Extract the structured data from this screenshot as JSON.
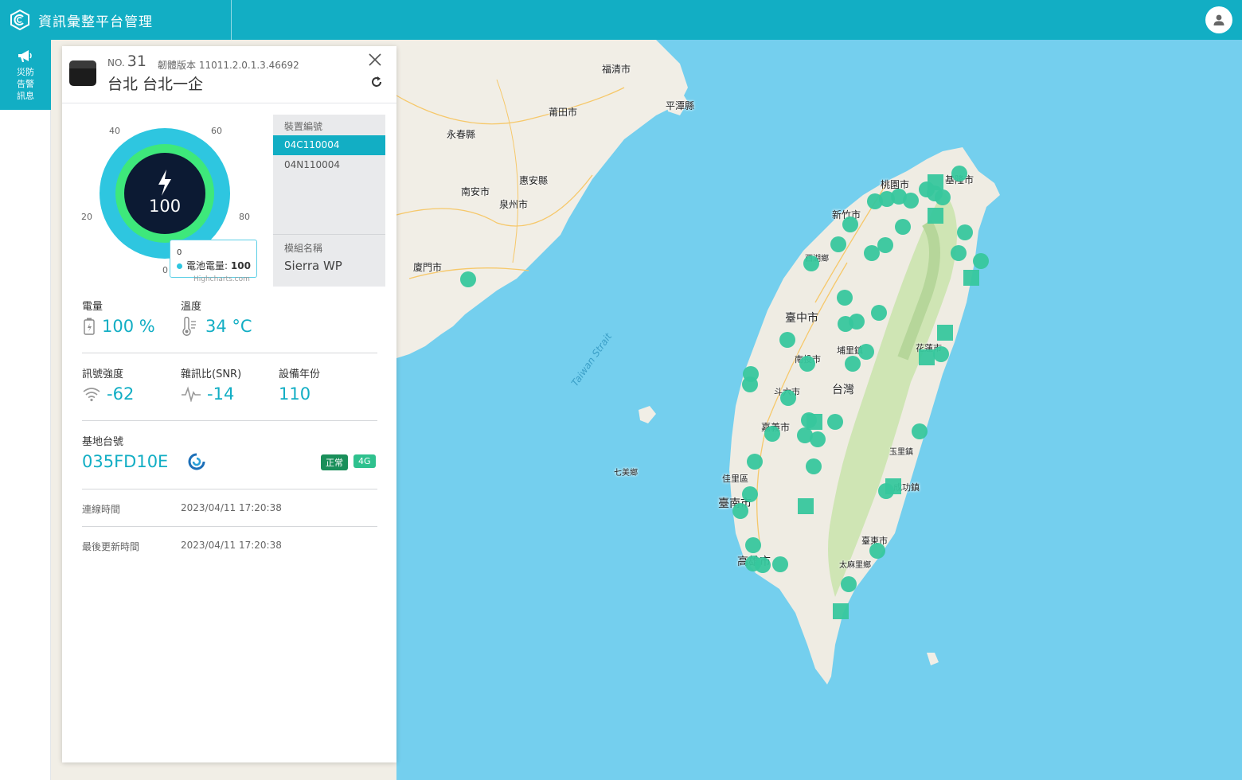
{
  "app": {
    "title": "資訊彙整平台管理"
  },
  "sidebar": {
    "items": [
      {
        "label": "災防告警訊息",
        "icon": "megaphone-icon"
      }
    ]
  },
  "map": {
    "places": [
      {
        "name": "福清市"
      },
      {
        "name": "平潭縣"
      },
      {
        "name": "莆田市"
      },
      {
        "name": "永春縣"
      },
      {
        "name": "惠安縣"
      },
      {
        "name": "南安市"
      },
      {
        "name": "泉州市"
      },
      {
        "name": "廈門市"
      },
      {
        "name": "桃園市"
      },
      {
        "name": "基隆市"
      },
      {
        "name": "新竹市"
      },
      {
        "name": "西湖鄉"
      },
      {
        "name": "臺中市"
      },
      {
        "name": "埔里鎮"
      },
      {
        "name": "南投市"
      },
      {
        "name": "花蓮市"
      },
      {
        "name": "斗六市"
      },
      {
        "name": "台灣"
      },
      {
        "name": "嘉義市"
      },
      {
        "name": "玉里鎮"
      },
      {
        "name": "七美鄉"
      },
      {
        "name": "佳里區"
      },
      {
        "name": "臺南市"
      },
      {
        "name": "成功鎮"
      },
      {
        "name": "臺東市"
      },
      {
        "name": "高雄市"
      },
      {
        "name": "太麻里鄉"
      },
      {
        "name": "Taiwan Strait"
      }
    ]
  },
  "device": {
    "no_label": "NO.",
    "no": "31",
    "firmware": "韌體版本 11011.2.0.1.3.46692",
    "site": "台北 台北一企",
    "gauge": {
      "value": "100",
      "ticks": [
        "0",
        "20",
        "40",
        "60",
        "80"
      ],
      "tooltip_zero": "0",
      "tooltip_label": "電池電量:",
      "tooltip_value": "100",
      "credit": "Highcharts.com"
    },
    "device_ids": {
      "header": "裝置編號",
      "items": [
        "04C110004",
        "04N110004"
      ],
      "selected": "04C110004"
    },
    "module": {
      "header": "模組名稱",
      "value": "Sierra WP"
    },
    "battery": {
      "label": "電量",
      "value": "100 %"
    },
    "temperature": {
      "label": "溫度",
      "value": "34 °C"
    },
    "signal": {
      "label": "訊號強度",
      "value": "-62"
    },
    "snr": {
      "label": "雜訊比(SNR)",
      "value": "-14"
    },
    "year": {
      "label": "設備年份",
      "value": "110"
    },
    "base_station": {
      "label": "基地台號",
      "value": "035FD10E",
      "status": "正常",
      "network": "4G"
    },
    "connect_time": {
      "label": "連線時間",
      "value": "2023/04/11 17:20:38"
    },
    "last_update": {
      "label": "最後更新時間",
      "value": "2023/04/11 17:20:38"
    }
  },
  "colors": {
    "accent": "#12aec4",
    "marker": "#37c79d",
    "gauge_outer": "#2ec6e0",
    "gauge_inner": "#3ee87b",
    "gauge_core": "#0c1a33",
    "badge_ok": "#1a8f5a"
  }
}
